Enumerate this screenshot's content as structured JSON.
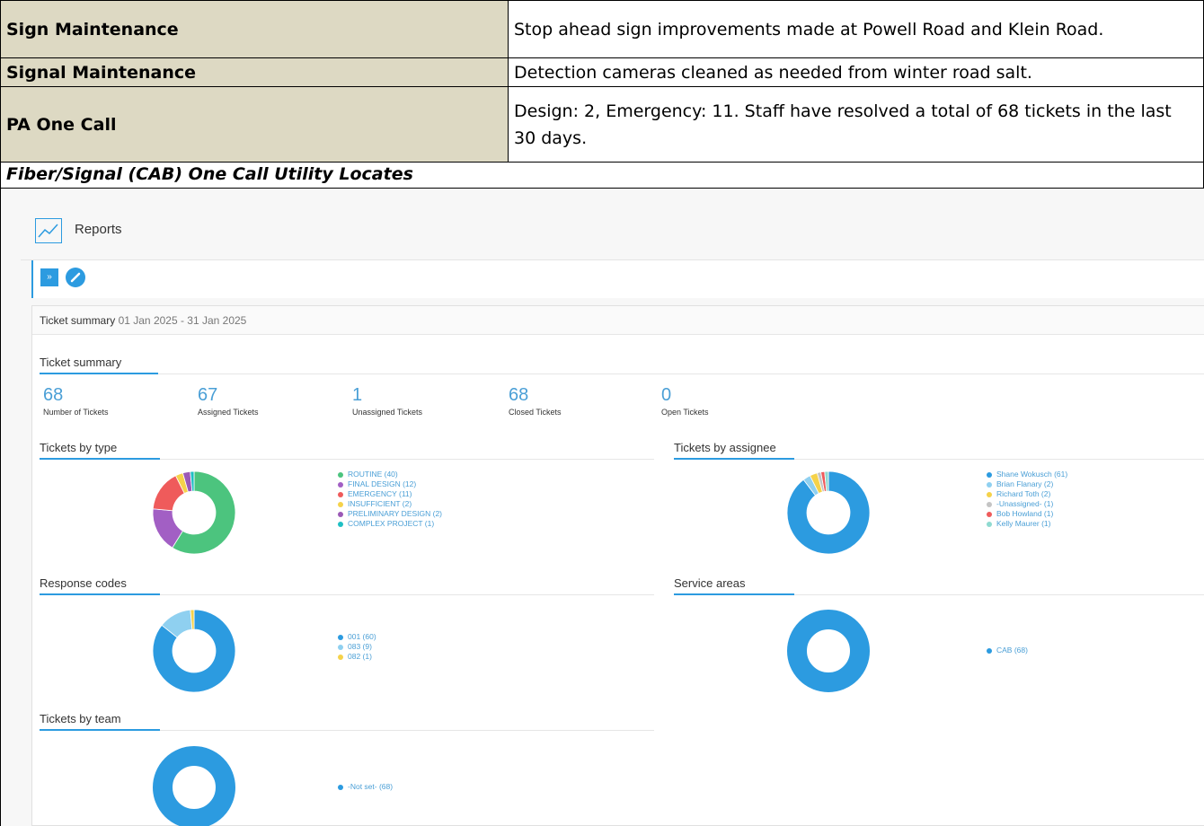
{
  "doc": {
    "rows": [
      {
        "label": "Sign Maintenance",
        "desc": "Stop ahead sign improvements made at Powell Road and Klein Road."
      },
      {
        "label": "Signal Maintenance",
        "desc": "Detection cameras cleaned as needed from winter road salt."
      },
      {
        "label": "PA One Call",
        "desc": "Design: 2, Emergency: 11. Staff have resolved a total of 68 tickets in the last 30 days."
      }
    ],
    "section_title": "Fiber/Signal (CAB) One Call Utility Locates"
  },
  "report": {
    "title": "Reports",
    "panel_title": "Ticket summary",
    "date_range": "01 Jan 2025 - 31 Jan 2025",
    "summary_heading": "Ticket summary",
    "stats": [
      {
        "value": "68",
        "label": "Number of Tickets"
      },
      {
        "value": "67",
        "label": "Assigned Tickets"
      },
      {
        "value": "1",
        "label": "Unassigned Tickets"
      },
      {
        "value": "68",
        "label": "Closed Tickets"
      },
      {
        "value": "0",
        "label": "Open Tickets"
      }
    ],
    "headings": {
      "by_type": "Tickets by type",
      "by_assignee": "Tickets by assignee",
      "response_codes": "Response codes",
      "service_areas": "Service areas",
      "by_team": "Tickets by team"
    }
  },
  "chart_data": [
    {
      "type": "pie",
      "donut": true,
      "title": "Tickets by type",
      "categories": [
        "ROUTINE (40)",
        "FINAL DESIGN (12)",
        "EMERGENCY (11)",
        "INSUFFICIENT (2)",
        "PRELIMINARY DESIGN (2)",
        "COMPLEX PROJECT (1)"
      ],
      "values": [
        40,
        12,
        11,
        2,
        2,
        1
      ],
      "colors": [
        "#4cc47e",
        "#a25fc4",
        "#ef5b5b",
        "#f5d24a",
        "#9b59b6",
        "#1fbfc4"
      ]
    },
    {
      "type": "pie",
      "donut": true,
      "title": "Tickets by assignee",
      "categories": [
        "Shane Wokusch (61)",
        "Brian Flanary (2)",
        "Richard Toth (2)",
        "-Unassigned- (1)",
        "Bob Howland (1)",
        "Kelly Maurer (1)"
      ],
      "values": [
        61,
        2,
        2,
        1,
        1,
        1
      ],
      "colors": [
        "#2c9be0",
        "#8fd0f0",
        "#f5d24a",
        "#c4c4c4",
        "#ef5b5b",
        "#8fdad0"
      ]
    },
    {
      "type": "pie",
      "donut": true,
      "title": "Response codes",
      "categories": [
        "001 (60)",
        "083 (9)",
        "082 (1)"
      ],
      "values": [
        60,
        9,
        1
      ],
      "colors": [
        "#2c9be0",
        "#8fd0f0",
        "#f5d24a"
      ]
    },
    {
      "type": "pie",
      "donut": true,
      "title": "Service areas",
      "categories": [
        "CAB (68)"
      ],
      "values": [
        68
      ],
      "colors": [
        "#2c9be0"
      ]
    },
    {
      "type": "pie",
      "donut": true,
      "title": "Tickets by team",
      "categories": [
        "-Not set- (68)"
      ],
      "values": [
        68
      ],
      "colors": [
        "#2c9be0"
      ]
    }
  ]
}
